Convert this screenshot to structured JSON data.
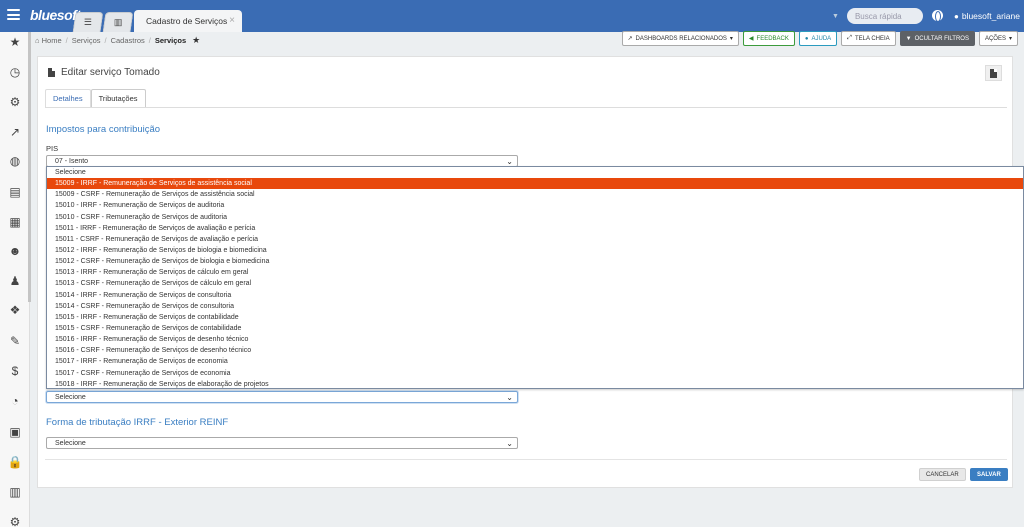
{
  "app": {
    "logo": "bluesoft",
    "tab_title": "Cadastro de Serviços",
    "tab_close": "×",
    "search_placeholder": "Busca rápida",
    "user": "bluesoft_ariane"
  },
  "sidebar": {
    "items": [
      {
        "icon": "star-icon",
        "glyph": "★"
      },
      {
        "icon": "clock-icon",
        "glyph": "◷"
      },
      {
        "icon": "gear-icon",
        "glyph": "⚙"
      },
      {
        "icon": "chart-icon",
        "glyph": "↗"
      },
      {
        "icon": "globe-icon",
        "glyph": "◍"
      },
      {
        "icon": "briefcase-icon",
        "glyph": "▤"
      },
      {
        "icon": "calculator-icon",
        "glyph": "▦"
      },
      {
        "icon": "users-icon",
        "glyph": "☻"
      },
      {
        "icon": "person-icon",
        "glyph": "♟"
      },
      {
        "icon": "cubes-icon",
        "glyph": "❖"
      },
      {
        "icon": "wrench-icon",
        "glyph": "✎"
      },
      {
        "icon": "dollar-icon",
        "glyph": "$"
      },
      {
        "icon": "gauge-icon",
        "glyph": "◔"
      },
      {
        "icon": "money-icon",
        "glyph": "▣"
      },
      {
        "icon": "lock-icon",
        "glyph": "🔒"
      },
      {
        "icon": "building-icon",
        "glyph": "▥"
      },
      {
        "icon": "cogs-icon",
        "glyph": "⚙"
      }
    ]
  },
  "breadcrumb": {
    "home": "Home",
    "items": [
      "Serviços",
      "Cadastros"
    ],
    "current": "Serviços"
  },
  "toolbar": {
    "dashboards": "Dashboards relacionados",
    "feedback": "Feedback",
    "ajuda": "Ajuda",
    "tela_cheia": "Tela cheia",
    "ocultar_filtros": "Ocultar filtros",
    "acoes": "Ações"
  },
  "page": {
    "title": "Editar serviço Tomado",
    "tabs": [
      "Detalhes",
      "Tributações"
    ],
    "active_tab": 1
  },
  "form": {
    "section1": "Impostos para contribuição",
    "pis_label": "PIS",
    "pis_value": "07 - Isento",
    "hidden_select_value": "Selecione",
    "section2": "Forma de tributação IRRF - Exterior REINF",
    "reinf_value": "Selecione"
  },
  "dropdown": {
    "highlighted_index": 1,
    "options": [
      "Selecione",
      "15009 - IRRF - Remuneração de Serviços de assistência social",
      "15009 - CSRF - Remuneração de Serviços de assistência social",
      "15010 - IRRF - Remuneração de Serviços de auditoria",
      "15010 - CSRF - Remuneração de Serviços de auditoria",
      "15011 - IRRF - Remuneração de Serviços de avaliação e perícia",
      "15011 - CSRF - Remuneração de Serviços de avaliação e perícia",
      "15012 - IRRF - Remuneração de Serviços de  biologia e biomedicina",
      "15012 - CSRF - Remuneração de Serviços de  biologia e biomedicina",
      "15013 - IRRF - Remuneração de Serviços de cálculo em geral",
      "15013 - CSRF - Remuneração de Serviços de cálculo em geral",
      "15014 - IRRF - Remuneração de Serviços de consultoria",
      "15014 - CSRF - Remuneração de Serviços de consultoria",
      "15015 - IRRF - Remuneração de Serviços de contabilidade",
      "15015 - CSRF - Remuneração de Serviços de contabilidade",
      "15016 - IRRF - Remuneração de Serviços de desenho técnico",
      "15016 - CSRF - Remuneração de Serviços de desenho técnico",
      "15017 - IRRF - Remuneração de Serviços de economia",
      "15017 - CSRF - Remuneração de Serviços de economia",
      "15018 - IRRF - Remuneração de Serviços de elaboração de projetos"
    ]
  },
  "actions": {
    "cancel": "Cancelar",
    "save": "Salvar"
  },
  "colors": {
    "topbar": "#3a6cb4",
    "highlight": "#e8480c",
    "accent": "#3a7ec2"
  }
}
